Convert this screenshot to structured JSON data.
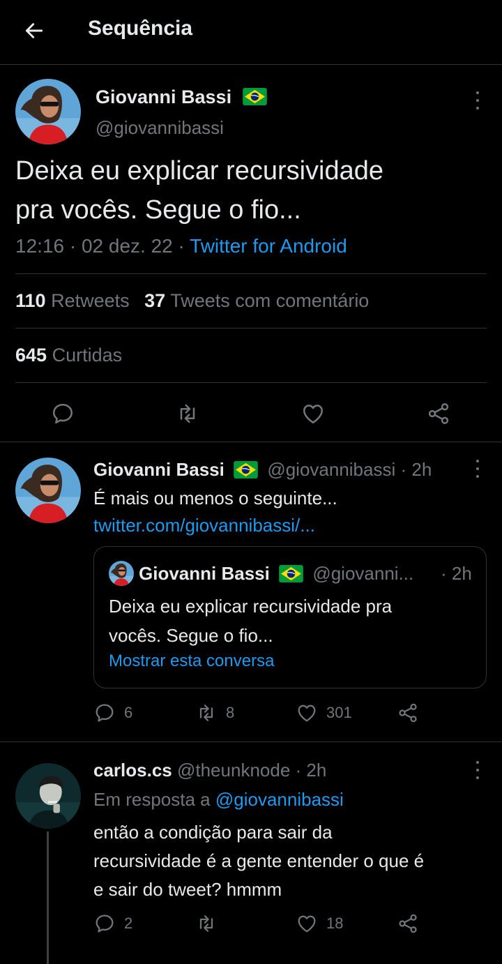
{
  "header": {
    "title": "Sequência"
  },
  "main_tweet": {
    "author_name": "Giovanni Bassi",
    "handle": "@giovannibassi",
    "text_line1": "Deixa eu explicar recursividade",
    "text_line2": "pra vocês. Segue o fio...",
    "time": "12:16",
    "sep1": "·",
    "date": "02 dez. 22",
    "sep2": "·",
    "source": "Twitter for Android",
    "retweets_count": "110",
    "retweets_label": "Retweets",
    "quotes_count": "37",
    "quotes_label": "Tweets com comentário",
    "likes_count": "645",
    "likes_label": "Curtidas"
  },
  "reply1": {
    "author_name": "Giovanni Bassi",
    "handle": "@giovannibassi",
    "sep": "·",
    "time": "2h",
    "text": "É mais ou menos o seguinte...",
    "link": "twitter.com/giovannibassi/...",
    "quote": {
      "author_name": "Giovanni Bassi",
      "handle": "@giovanni...",
      "time": "· 2h",
      "text_line1": "Deixa eu explicar recursividade pra",
      "text_line2": "vocês. Segue o fio...",
      "show_conversation": "Mostrar esta conversa"
    },
    "replies": "6",
    "retweets": "8",
    "likes": "301"
  },
  "reply2": {
    "author_name": "carlos.cs",
    "handle": "@theunknode",
    "sep": "·",
    "time": "2h",
    "in_reply_prefix": "Em resposta a",
    "in_reply_handle": "@giovannibassi",
    "text_line1": "então a condição para sair da",
    "text_line2": "recursividade é a gente entender o que é",
    "text_line3": "e sair do tweet? hmmm",
    "replies": "2",
    "retweets": "",
    "likes": "18"
  },
  "colors": {
    "background": "#000000",
    "text": "#e7e9ea",
    "muted": "#71767b",
    "accent": "#1d9bf0",
    "divider": "#2f3336"
  },
  "icons": [
    "back-arrow-icon",
    "more-icon",
    "reply-icon",
    "retweet-icon",
    "like-icon",
    "share-icon",
    "brazil-flag-icon"
  ]
}
